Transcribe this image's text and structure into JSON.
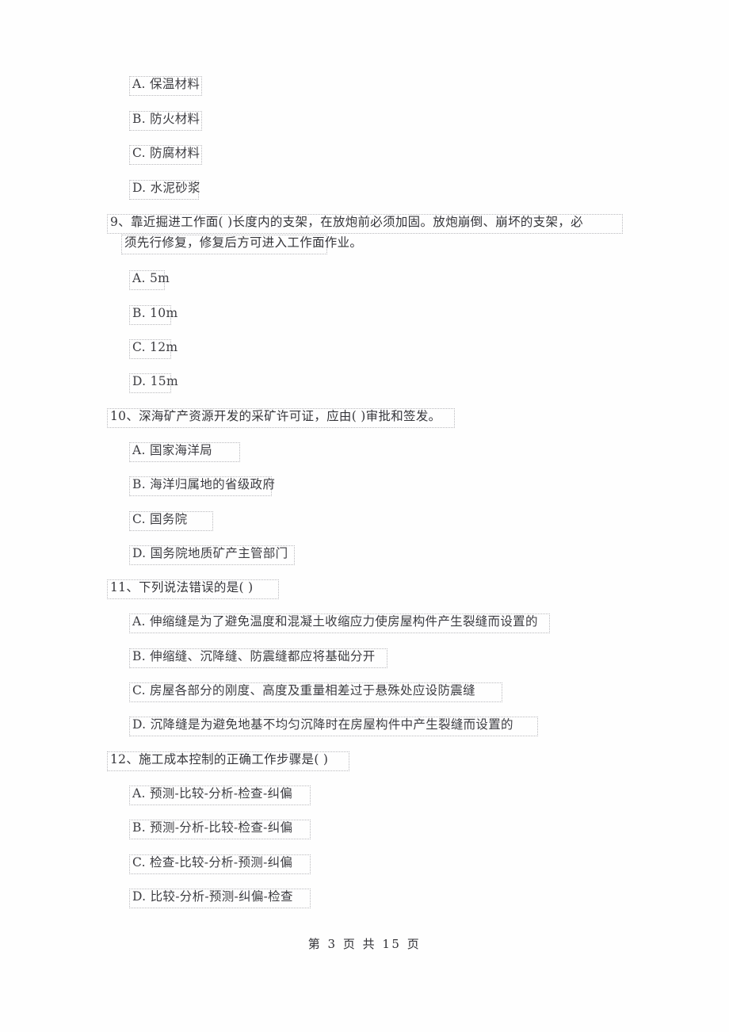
{
  "document": {
    "type": "exam-paper-scan",
    "page_footer": "第 3 页 共 15 页",
    "page_number": "3",
    "total_pages": "15"
  },
  "colors": {
    "text": "#3d3d42",
    "box_border": "#b9b9bd",
    "page_background": "#ffffff"
  },
  "carryover_options": [
    {
      "label": "A. 保温材料"
    },
    {
      "label": "B. 防火材料"
    },
    {
      "label": "C. 防腐材料"
    },
    {
      "label": "D. 水泥砂浆"
    }
  ],
  "questions": [
    {
      "number": "9",
      "stem_line1": "9、靠近掘进工作面(     )长度内的支架，在放炮前必须加固。放炮崩倒、崩坏的支架，必",
      "stem_line2": "须先行修复，修复后方可进入工作面作业。",
      "options": [
        {
          "label": "A. 5m"
        },
        {
          "label": "B. 10m"
        },
        {
          "label": "C. 12m"
        },
        {
          "label": "D. 15m"
        }
      ]
    },
    {
      "number": "10",
      "stem_line1": "10、深海矿产资源开发的采矿许可证，应由( )审批和签发。",
      "options": [
        {
          "label": "A. 国家海洋局"
        },
        {
          "label": "B. 海洋归属地的省级政府"
        },
        {
          "label": "C. 国务院"
        },
        {
          "label": "D. 国务院地质矿产主管部门"
        }
      ]
    },
    {
      "number": "11",
      "stem_line1": "11、下列说法错误的是(     )",
      "options": [
        {
          "label": "A. 伸缩缝是为了避免温度和混凝土收缩应力使房屋构件产生裂缝而设置的"
        },
        {
          "label": "B. 伸缩缝、沉降缝、防震缝都应将基础分开"
        },
        {
          "label": "C. 房屋各部分的刚度、高度及重量相差过于悬殊处应设防震缝"
        },
        {
          "label": "D. 沉降缝是为避免地基不均匀沉降时在房屋构件中产生裂缝而设置的"
        }
      ]
    },
    {
      "number": "12",
      "stem_line1": "12、施工成本控制的正确工作步骤是(   )",
      "options": [
        {
          "label": "A. 预测-比较-分析-检查-纠偏"
        },
        {
          "label": "B. 预测-分析-比较-检查-纠偏"
        },
        {
          "label": "C. 检查-比较-分析-预测-纠偏"
        },
        {
          "label": "D. 比较-分析-预测-纠偏-检查"
        }
      ]
    }
  ]
}
